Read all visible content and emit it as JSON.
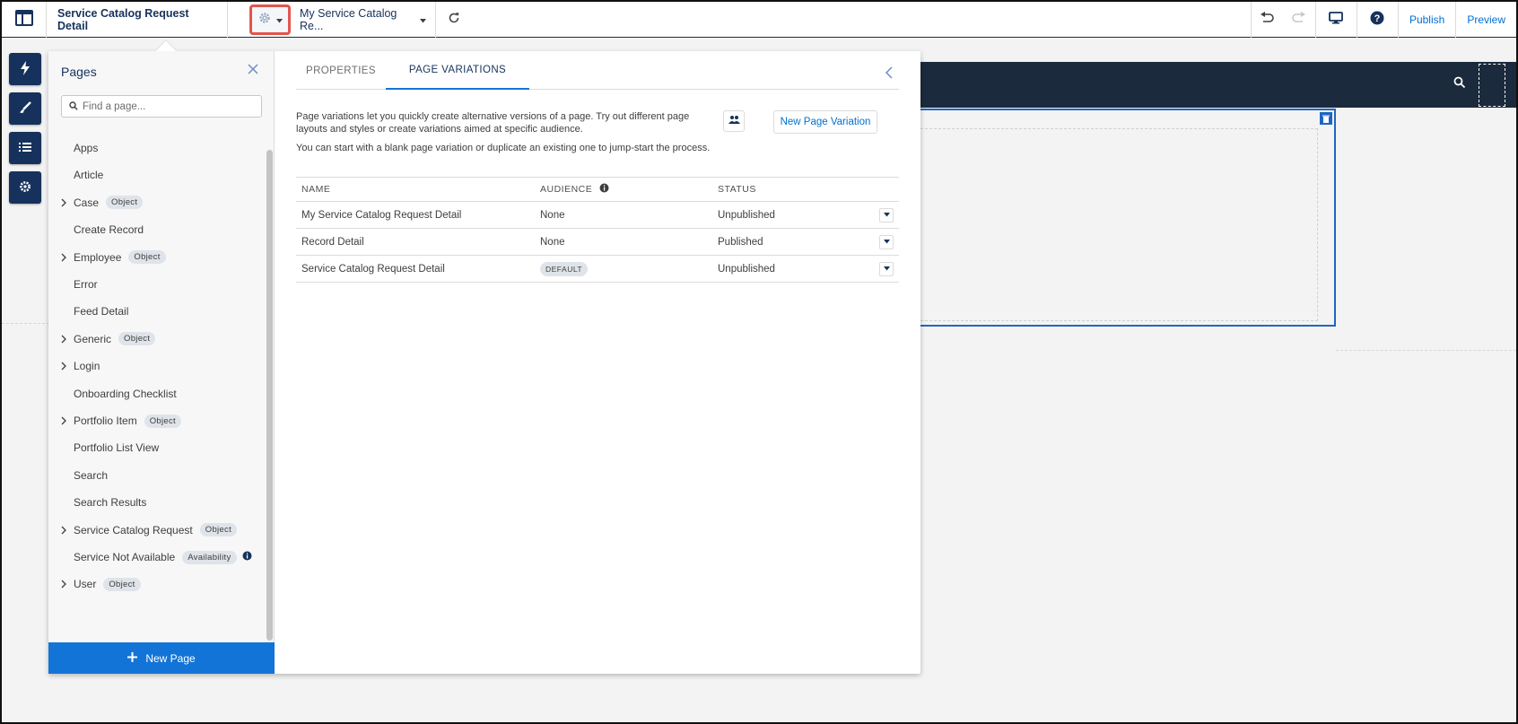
{
  "topbar": {
    "page_title": "Service Catalog Request Detail",
    "page_variation_label": "My Service Catalog Re...",
    "publish_label": "Publish",
    "preview_label": "Preview"
  },
  "pages_panel": {
    "title": "Pages",
    "search_placeholder": "Find a page...",
    "items": [
      {
        "label": "Apps",
        "badge": "",
        "expandable": false
      },
      {
        "label": "Article",
        "badge": "",
        "expandable": false
      },
      {
        "label": "Case",
        "badge": "Object",
        "expandable": true
      },
      {
        "label": "Create Record",
        "badge": "",
        "expandable": false
      },
      {
        "label": "Employee",
        "badge": "Object",
        "expandable": true
      },
      {
        "label": "Error",
        "badge": "",
        "expandable": false
      },
      {
        "label": "Feed Detail",
        "badge": "",
        "expandable": false
      },
      {
        "label": "Generic",
        "badge": "Object",
        "expandable": true
      },
      {
        "label": "Login",
        "badge": "",
        "expandable": true
      },
      {
        "label": "Onboarding Checklist",
        "badge": "",
        "expandable": false
      },
      {
        "label": "Portfolio Item",
        "badge": "Object",
        "expandable": true
      },
      {
        "label": "Portfolio List View",
        "badge": "",
        "expandable": false
      },
      {
        "label": "Search",
        "badge": "",
        "expandable": false
      },
      {
        "label": "Search Results",
        "badge": "",
        "expandable": false
      },
      {
        "label": "Service Catalog Request",
        "badge": "Object",
        "expandable": true
      },
      {
        "label": "Service Not Available",
        "badge": "Availability",
        "expandable": false
      },
      {
        "label": "User",
        "badge": "Object",
        "expandable": true
      }
    ],
    "new_page_label": "New Page"
  },
  "detail_panel": {
    "tabs": [
      {
        "label": "PROPERTIES"
      },
      {
        "label": "PAGE VARIATIONS"
      }
    ],
    "description": "Page variations let you quickly create alternative versions of a page. Try out different page layouts and styles or create variations aimed at specific audience.",
    "description2": "You can start with a blank page variation or duplicate an existing one to jump-start the process.",
    "new_variation_label": "New Page Variation",
    "columns": {
      "name": "NAME",
      "audience": "AUDIENCE",
      "status": "STATUS"
    },
    "rows": [
      {
        "name": "My Service Catalog Request Detail",
        "audience": "None",
        "status": "Unpublished"
      },
      {
        "name": "Record Detail",
        "audience": "None",
        "status": "Published"
      },
      {
        "name": "Service Catalog Request Detail",
        "audience": "DEFAULT",
        "status": "Unpublished"
      }
    ]
  },
  "colors": {
    "accent": "#1374d8",
    "navy": "#16325c",
    "highlight": "#e2554d"
  }
}
